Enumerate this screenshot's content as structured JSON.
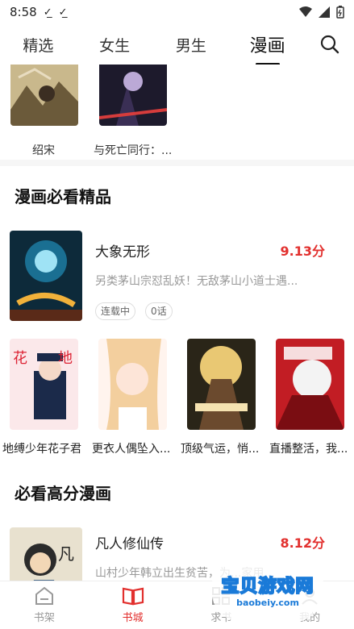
{
  "status": {
    "time": "8:58"
  },
  "tabs": [
    {
      "label": "精选"
    },
    {
      "label": "女生"
    },
    {
      "label": "男生"
    },
    {
      "label": "漫画"
    }
  ],
  "top_row": [
    {
      "title": "绍宋"
    },
    {
      "title": "与死亡同行：..."
    }
  ],
  "section1": {
    "title": "漫画必看精品",
    "feature": {
      "title": "大象无形",
      "score": "9.13分",
      "desc": "另类茅山宗怼乱妖！无敌茅山小道士遇...",
      "badges": [
        "连载中",
        "0话"
      ]
    },
    "grid": [
      {
        "title": "地缚少年花子君"
      },
      {
        "title": "更衣人偶坠入..."
      },
      {
        "title": "顶级气运，悄..."
      },
      {
        "title": "直播整活，我..."
      }
    ]
  },
  "section2": {
    "title": "必看高分漫画",
    "feature": {
      "title": "凡人修仙传",
      "score": "8.12分",
      "desc": "山村少年韩立出生贫苦，为...家用..."
    }
  },
  "bottom_nav": [
    {
      "label": "书架"
    },
    {
      "label": "书城"
    },
    {
      "label": "求书"
    },
    {
      "label": "我的"
    }
  ],
  "watermark": {
    "title": "宝贝游戏网",
    "url": "baobeiy.com"
  },
  "colors": {
    "accent": "#e2302e",
    "muted": "#999999"
  }
}
